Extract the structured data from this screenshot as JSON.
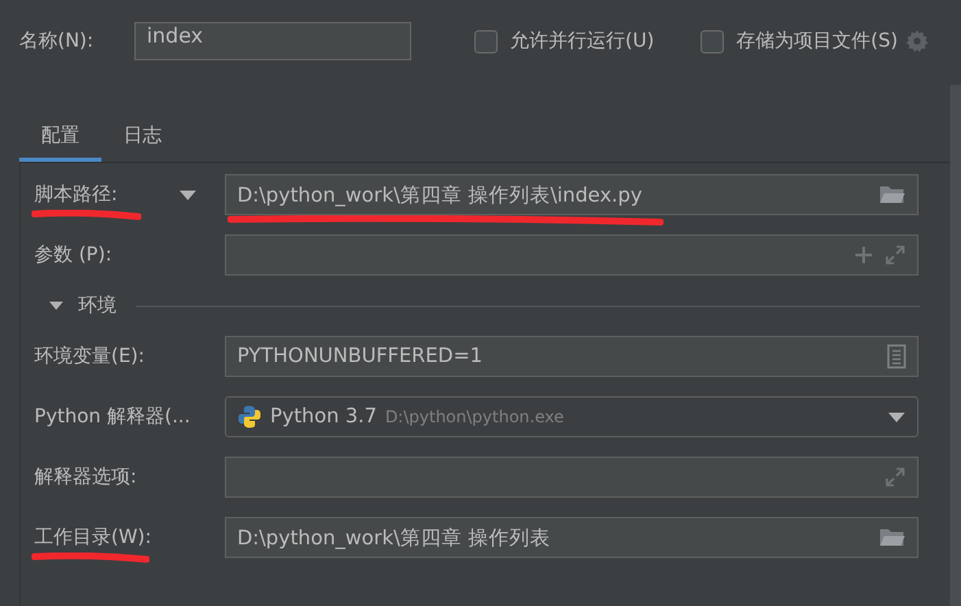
{
  "name_field": {
    "label": "名称(N):",
    "value": "index"
  },
  "options": [
    {
      "label": "允许并行运行(U)",
      "checked": false
    },
    {
      "label": "存储为项目文件(S)",
      "checked": false
    }
  ],
  "tabs": [
    {
      "label": "配置",
      "selected": true
    },
    {
      "label": "日志",
      "selected": false
    }
  ],
  "rows": [
    {
      "kind": "path",
      "label": "脚本路径:",
      "value": "D:\\python_work\\第四章 操作列表\\index.py",
      "menu": true,
      "marked_label": true,
      "marked_value": true
    },
    {
      "kind": "args",
      "label": "参数 (P):"
    },
    {
      "kind": "section",
      "label": "环境",
      "expanded": true
    },
    {
      "kind": "env",
      "label": "环境变量(E):",
      "value": "PYTHONUNBUFFERED=1"
    },
    {
      "kind": "interpreter",
      "label": "Python 解释器(...",
      "value": "Python 3.7",
      "detail": "D:\\python\\python.exe"
    },
    {
      "kind": "options",
      "label": "解释器选项:"
    },
    {
      "kind": "path",
      "label": "工作目录(W):",
      "value": "D:\\python_work\\第四章 操作列表",
      "marked_label": true
    }
  ]
}
